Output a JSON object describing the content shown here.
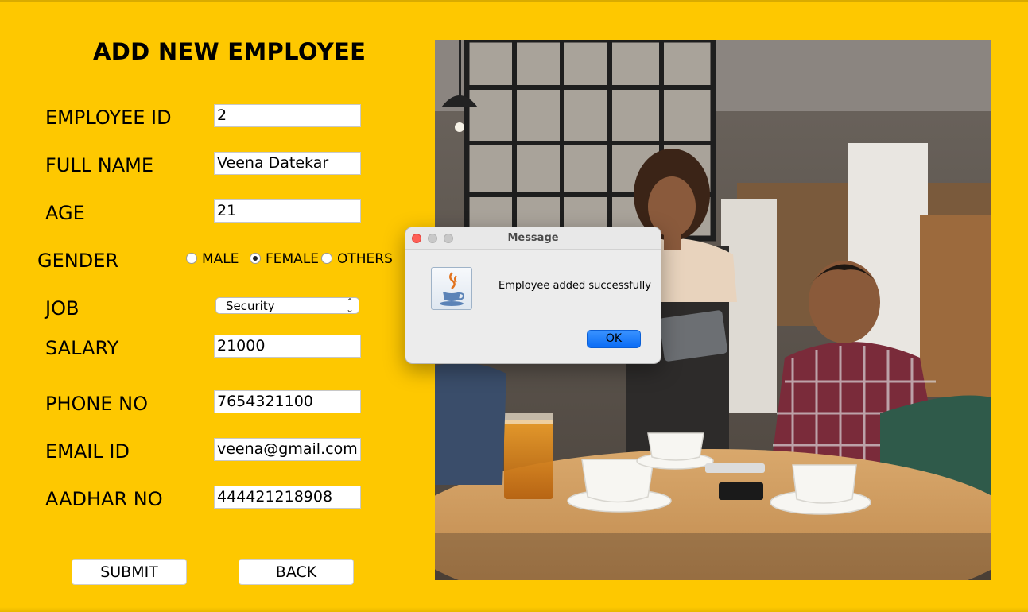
{
  "form": {
    "title": "ADD NEW EMPLOYEE",
    "labels": {
      "employee_id": "EMPLOYEE ID",
      "full_name": "FULL NAME",
      "age": "AGE",
      "gender": "GENDER",
      "job": "JOB",
      "salary": "SALARY",
      "phone": "PHONE NO",
      "email": "EMAIL ID",
      "aadhar": "AADHAR NO"
    },
    "values": {
      "employee_id": "2",
      "full_name": "Veena Datekar",
      "age": "21",
      "salary": "21000",
      "phone": "7654321100",
      "email": "veena@gmail.com",
      "aadhar": "444421218908"
    },
    "gender_options": [
      "MALE",
      "FEMALE",
      "OTHERS"
    ],
    "gender_selected": "FEMALE",
    "job_selected": "Security",
    "buttons": {
      "submit": "SUBMIT",
      "back": "BACK"
    }
  },
  "dialog": {
    "title": "Message",
    "message": "Employee added successfully",
    "ok_label": "OK",
    "icon": "java-coffee-cup-icon"
  },
  "photo": {
    "icon": "restaurant-photo"
  },
  "colors": {
    "background": "#fec800",
    "ok_button": "#0a6cf5",
    "close_dot": "#fe5f57",
    "inactive_dot": "#c8c8c8"
  }
}
